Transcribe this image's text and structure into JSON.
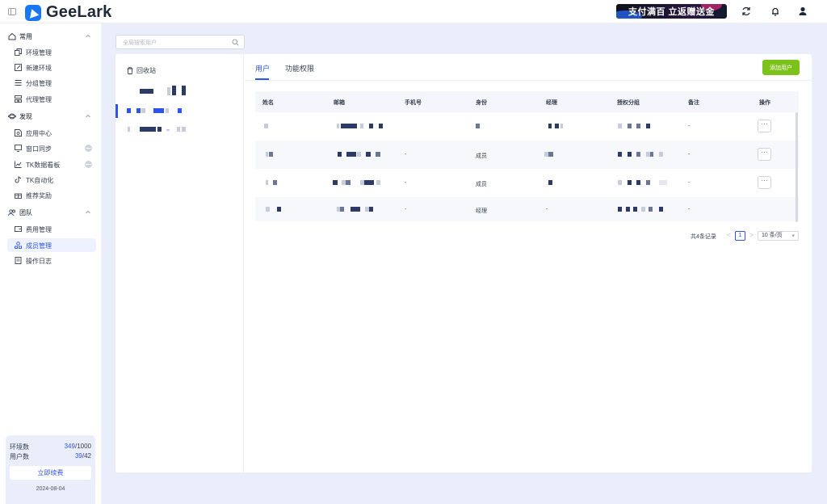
{
  "app": {
    "name": "GeeLark"
  },
  "header": {
    "promo_text": "支付满百 立返赠送金"
  },
  "sidebar": {
    "sections": [
      {
        "label": "常用",
        "items": [
          {
            "label": "环境管理",
            "icon": "copy-icon"
          },
          {
            "label": "新建环境",
            "icon": "edit-icon"
          },
          {
            "label": "分组管理",
            "icon": "list-icon"
          },
          {
            "label": "代理管理",
            "icon": "proxy-icon"
          }
        ]
      },
      {
        "label": "发现",
        "items": [
          {
            "label": "应用中心",
            "icon": "app-icon"
          },
          {
            "label": "窗口同步",
            "icon": "window-icon"
          },
          {
            "label": "TK数据看板",
            "icon": "chart-icon"
          },
          {
            "label": "TK自动化",
            "icon": "tiktok-icon"
          },
          {
            "label": "推荐奖励",
            "icon": "gift-icon"
          }
        ]
      },
      {
        "label": "团队",
        "items": [
          {
            "label": "费用管理",
            "icon": "wallet-icon"
          },
          {
            "label": "成员管理",
            "icon": "members-icon",
            "active": true
          },
          {
            "label": "操作日志",
            "icon": "log-icon"
          }
        ]
      }
    ],
    "quota": {
      "env_label": "环境数",
      "env_used": "349",
      "env_total": "/1000",
      "user_label": "用户数",
      "user_used": "39",
      "user_total": "/42",
      "renew_label": "立即续费",
      "date": "2024-08-04"
    }
  },
  "search": {
    "placeholder": "全局搜索用户"
  },
  "groups": {
    "recycle_label": "回收站"
  },
  "tabs": [
    {
      "label": "用户",
      "active": true
    },
    {
      "label": "功能权限"
    }
  ],
  "actions": {
    "add_user_label": "添加用户"
  },
  "table": {
    "columns": [
      "姓名",
      "邮箱",
      "手机号",
      "身份",
      "经理",
      "授权分组",
      "备注",
      "操作"
    ],
    "rows": [
      {
        "phone": "",
        "role": "",
        "manager": "",
        "note": "-",
        "has_action": true
      },
      {
        "phone": "-",
        "role": "成员",
        "manager": "",
        "note": "-",
        "has_action": true
      },
      {
        "phone": "-",
        "role": "成员",
        "manager": "",
        "note": "-",
        "has_action": true
      },
      {
        "phone": "-",
        "role": "经理",
        "manager": "-",
        "note": "-",
        "has_action": false
      }
    ],
    "more_label": "···"
  },
  "pagination": {
    "total": "共4条记录",
    "prev": "<",
    "current": "1",
    "next": ">",
    "page_size": "10 条/页"
  },
  "colors": {
    "accent": "#2f54eb",
    "add_button": "#7cc21b",
    "brand": "#1877f2"
  }
}
